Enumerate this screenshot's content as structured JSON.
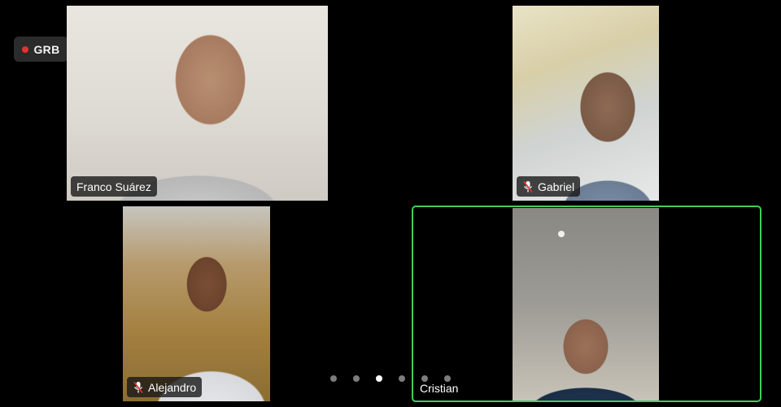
{
  "recording": {
    "label": "GRB",
    "indicator_color": "#e8322b"
  },
  "participants": [
    {
      "name": "Franco Suárez",
      "muted": false
    },
    {
      "name": "Gabriel",
      "muted": true
    },
    {
      "name": "Alejandro",
      "muted": true
    },
    {
      "name": "Cristian",
      "muted": false,
      "active_speaker": true
    }
  ],
  "active_speaker_color": "#3fcf5b",
  "pager": {
    "pages": 6,
    "current": 3
  },
  "icons": {
    "muted_mic": "mic-off-icon"
  }
}
